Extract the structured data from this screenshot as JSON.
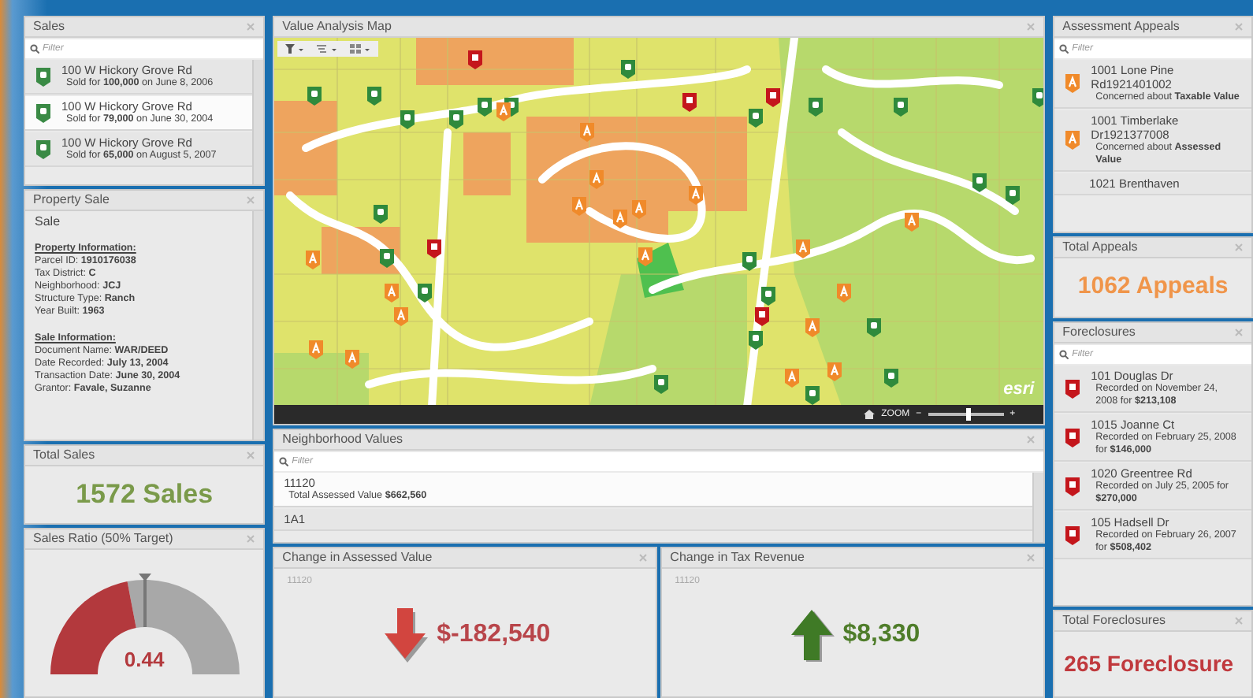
{
  "sales": {
    "title": "Sales",
    "filter": {
      "placeholder": "Filter"
    },
    "items": [
      {
        "address": "100 W Hickory Grove Rd",
        "detail": "Sold for **100,000** on June 8, 2006",
        "selected": false
      },
      {
        "address": "100 W Hickory Grove Rd",
        "detail": "Sold for **79,000** on June 30, 2004",
        "selected": true
      },
      {
        "address": "100 W Hickory Grove Rd",
        "detail": "Sold for **65,000** on August 5, 2007",
        "selected": false
      }
    ]
  },
  "property_sale": {
    "title": "Property Sale",
    "heading": "Sale",
    "sections": [
      {
        "heading": "Property Information:",
        "lines": [
          "Parcel ID: **1910176038**",
          "Tax District: **C**",
          "Neighborhood: **JCJ**",
          "Structure Type: **Ranch**",
          "Year Built: **1963**"
        ]
      },
      {
        "heading": "Sale Information:",
        "lines": [
          "Document Name: **WAR/DEED**",
          "Date Recorded: **July 13, 2004**",
          "Transaction Date: **June 30, 2004**",
          "Grantor: **Favale, Suzanne**"
        ]
      }
    ]
  },
  "total_sales": {
    "title": "Total Sales",
    "value": "1572 Sales"
  },
  "sales_ratio": {
    "title": "Sales Ratio (50% Target)",
    "level": 0.44,
    "reading": "0.44"
  },
  "map": {
    "title": "Value Analysis Map",
    "logo": "esri",
    "zoom": {
      "label": "ZOOM",
      "minus": "−",
      "plus": "+",
      "level": 0.55
    }
  },
  "neighborhood_values": {
    "title": "Neighborhood Values",
    "filter": {
      "placeholder": "Filter"
    },
    "items": [
      {
        "name": "11120",
        "detail": "Total Assessed Value **$662,560**",
        "selected": true
      },
      {
        "name": "1A1",
        "selected": false
      }
    ]
  },
  "change_assessed_value": {
    "title": "Change in Assessed Value",
    "label": "11120",
    "value": "$-182,540",
    "kind": "down"
  },
  "change_tax_revenue": {
    "title": "Change in Tax Revenue",
    "label": "11120",
    "value": "$8,330",
    "kind": "up"
  },
  "assessment_appeals": {
    "title": "Assessment Appeals",
    "filter": {
      "placeholder": "Filter"
    },
    "items": [
      {
        "name": "1001 Lone Pine Rd1921401002",
        "detail": "Concerned about **Taxable Value**"
      },
      {
        "name": "1001 Timberlake Dr1921377008",
        "detail": "Concerned about **Assessed Value**"
      },
      {
        "name": "1021 Brenthaven"
      }
    ]
  },
  "total_appeals": {
    "title": "Total Appeals",
    "value": "1062 Appeals"
  },
  "foreclosures": {
    "title": "Foreclosures",
    "filter": {
      "placeholder": "Filter"
    },
    "items": [
      {
        "address": "101 Douglas Dr",
        "detail": "Recorded on November 24, 2008 for **$213,108**"
      },
      {
        "address": "1015 Joanne Ct",
        "detail": "Recorded on February 25, 2008 for **$146,000**"
      },
      {
        "address": "1020 Greentree Rd",
        "detail": "Recorded on July 25, 2005 for **$270,000**"
      },
      {
        "address": "105 Hadsell Dr",
        "detail": "Recorded on February 26, 2007 for **$508,402**"
      }
    ]
  },
  "total_foreclosures": {
    "title": "Total Foreclosures",
    "value": "265 Foreclosure"
  }
}
